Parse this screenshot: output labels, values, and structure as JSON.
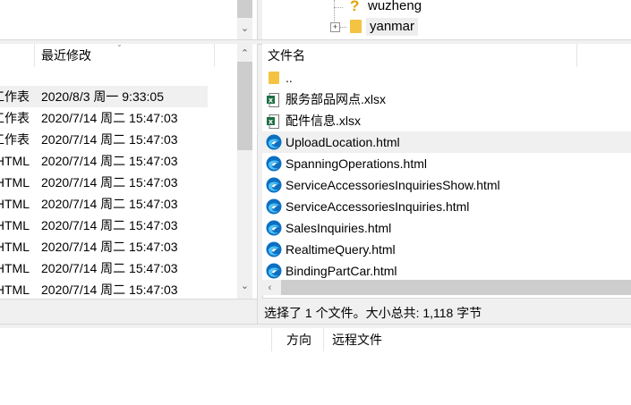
{
  "tree": {
    "items": [
      {
        "label": "wuzheng",
        "icon": "question-folder-icon"
      },
      {
        "label": "yanmar",
        "icon": "folder-icon",
        "expander": "⊞"
      }
    ]
  },
  "local_list": {
    "header_modified": "最近修改",
    "rows": [
      {
        "type": "工作表",
        "modified": "2020/8/3 周一 9:33:05"
      },
      {
        "type": "工作表",
        "modified": "2020/7/14 周二 15:47:03"
      },
      {
        "type": "工作表",
        "modified": "2020/7/14 周二 15:47:03"
      },
      {
        "type": "HTML",
        "modified": "2020/7/14 周二 15:47:03"
      },
      {
        "type": "HTML",
        "modified": "2020/7/14 周二 15:47:03"
      },
      {
        "type": "HTML",
        "modified": "2020/7/14 周二 15:47:03"
      },
      {
        "type": "HTML",
        "modified": "2020/7/14 周二 15:47:03"
      },
      {
        "type": "HTML",
        "modified": "2020/7/14 周二 15:47:03"
      },
      {
        "type": "HTML",
        "modified": "2020/7/14 周二 15:47:03"
      },
      {
        "type": "HTML",
        "modified": "2020/7/14 周二 15:47:03"
      }
    ]
  },
  "remote_list": {
    "header_name": "文件名",
    "parent": "..",
    "files": [
      {
        "name": "服务部品网点.xlsx",
        "icon": "xlsx-icon"
      },
      {
        "name": "配件信息.xlsx",
        "icon": "xlsx-icon"
      },
      {
        "name": "UploadLocation.html",
        "icon": "edge-icon"
      },
      {
        "name": "SpanningOperations.html",
        "icon": "edge-icon"
      },
      {
        "name": "ServiceAccessoriesInquiriesShow.html",
        "icon": "edge-icon"
      },
      {
        "name": "ServiceAccessoriesInquiries.html",
        "icon": "edge-icon"
      },
      {
        "name": "SalesInquiries.html",
        "icon": "edge-icon"
      },
      {
        "name": "RealtimeQuery.html",
        "icon": "edge-icon"
      },
      {
        "name": "BindingPartCar.html",
        "icon": "edge-icon"
      }
    ]
  },
  "status": {
    "remote": "选择了 1 个文件。大小总共: 1,118 字节"
  },
  "queue": {
    "col_direction": "方向",
    "col_remote_file": "远程文件"
  },
  "colors": {
    "selected_row": "#f0f0f0",
    "folder": "#f5c342",
    "xlsx_green": "#1d6f42",
    "edge_blue": "#0c6fc1"
  }
}
